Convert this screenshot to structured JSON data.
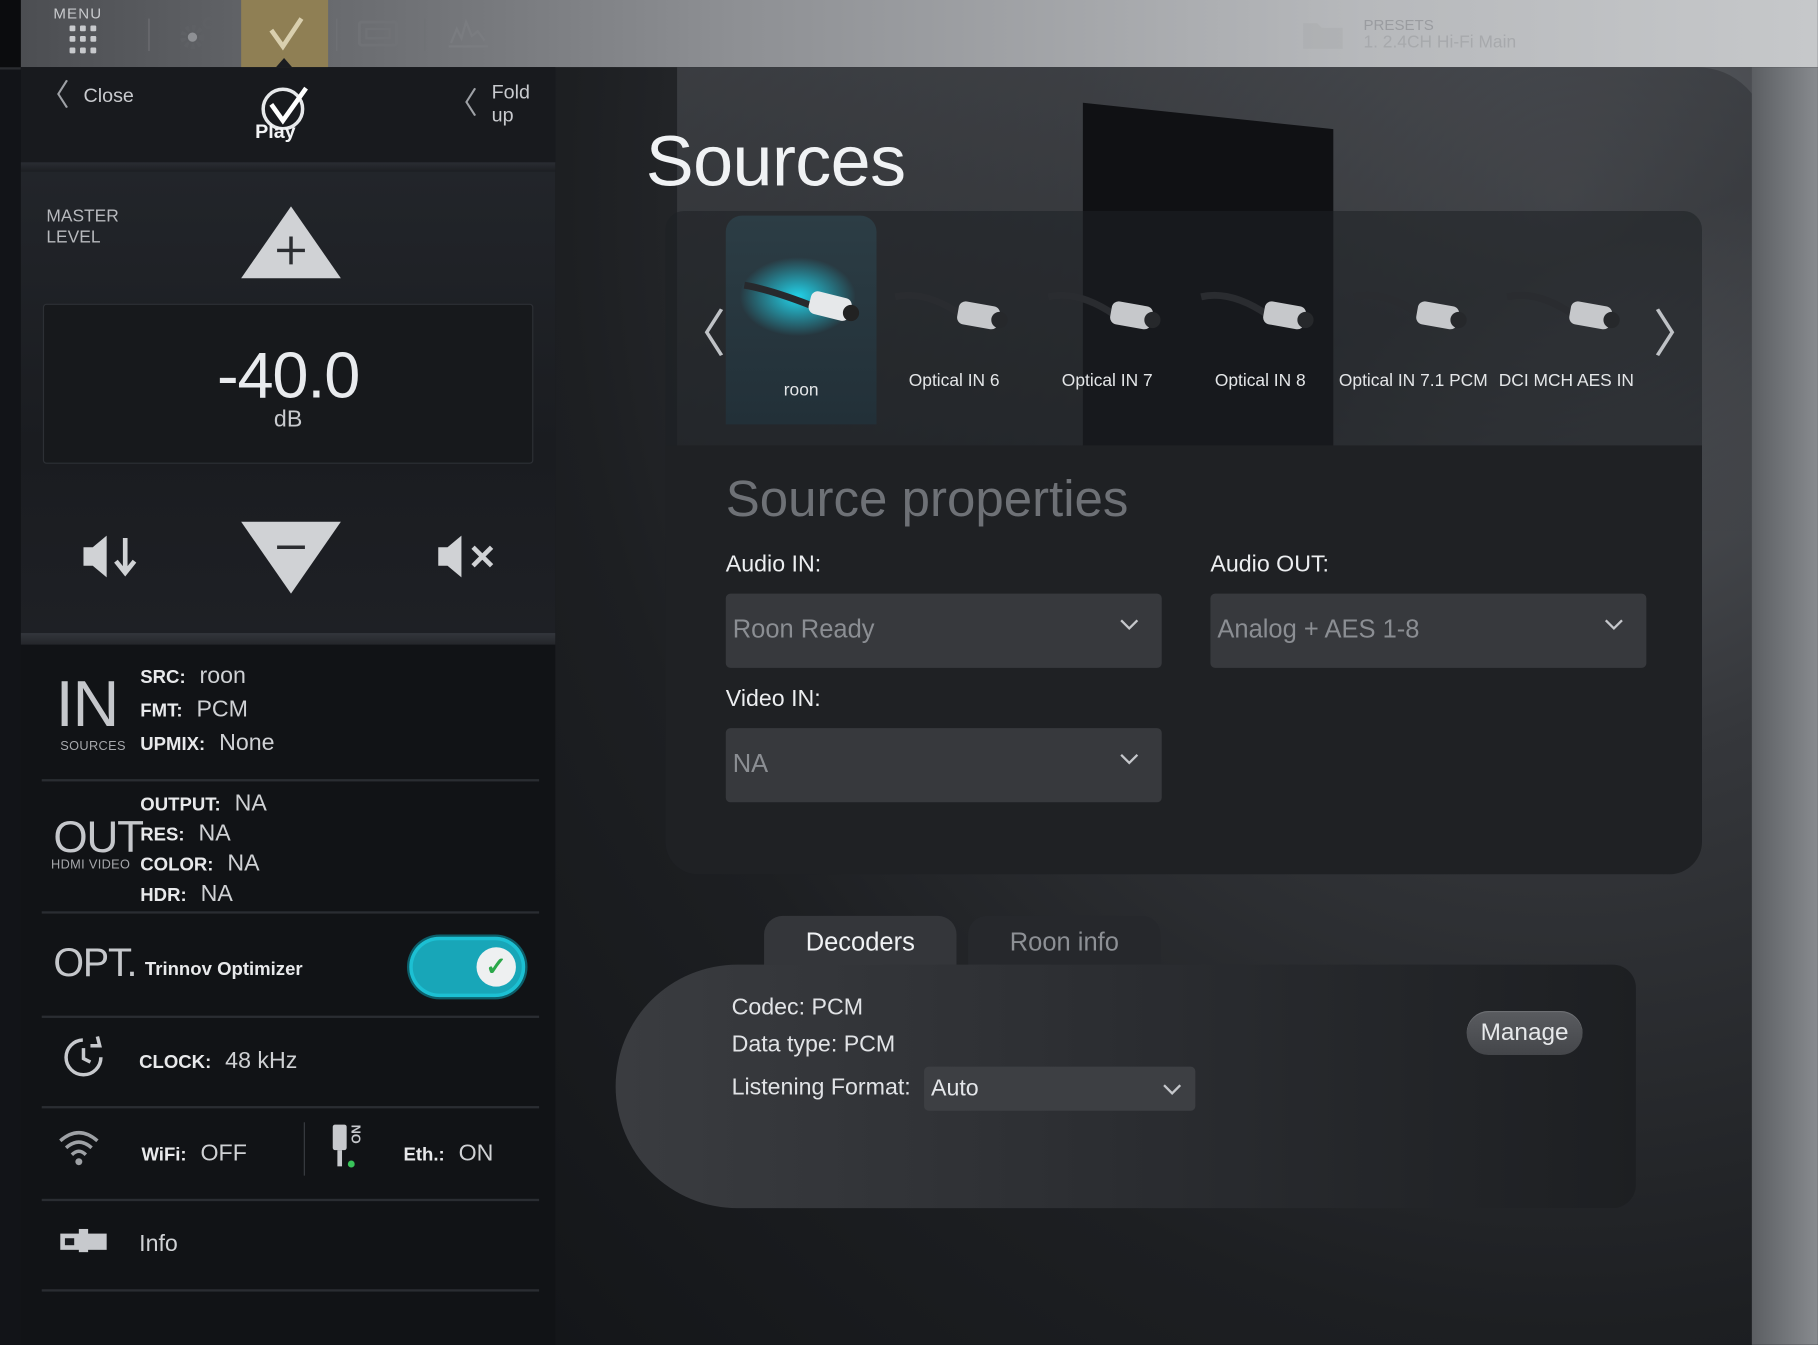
{
  "topbar": {
    "menu_label": "MENU",
    "presets_label": "PRESETS",
    "preset_current": "1. 2.4CH Hi-Fi Main"
  },
  "left_panel": {
    "close_label": "Close",
    "foldup_label": "Fold up",
    "logo_text": "Play",
    "master_level_label": "MASTER LEVEL",
    "volume_value": "-40.0",
    "volume_unit": "dB",
    "in_section": {
      "big": "IN",
      "small": "SOURCES",
      "src_key": "SRC:",
      "src_val": "roon",
      "fmt_key": "FMT:",
      "fmt_val": "PCM",
      "upmix_key": "UPMIX:",
      "upmix_val": "None"
    },
    "out_section": {
      "big": "OUT",
      "small": "HDMI VIDEO",
      "output_key": "OUTPUT:",
      "output_val": "NA",
      "res_key": "RES:",
      "res_val": "NA",
      "color_key": "COLOR:",
      "color_val": "NA",
      "hdr_key": "HDR:",
      "hdr_val": "NA"
    },
    "opt_section": {
      "big": "OPT.",
      "label": "Trinnov Optimizer",
      "enabled": true
    },
    "clock_section": {
      "key": "CLOCK:",
      "val": "48 kHz"
    },
    "network_section": {
      "wifi_key": "WiFi:",
      "wifi_val": "OFF",
      "eth_key": "Eth.:",
      "eth_val": "ON",
      "eth_icon_text": "ON"
    },
    "info_label": "Info"
  },
  "main": {
    "title": "Sources",
    "sources": [
      {
        "label": "roon",
        "active": true
      },
      {
        "label": "Optical IN 6",
        "active": false
      },
      {
        "label": "Optical IN 7",
        "active": false
      },
      {
        "label": "Optical IN 8",
        "active": false
      },
      {
        "label": "Optical IN 7.1 PCM",
        "active": false
      },
      {
        "label": "DCI MCH AES IN",
        "active": false
      }
    ],
    "properties": {
      "title": "Source properties",
      "audio_in_label": "Audio IN:",
      "audio_in_value": "Roon Ready",
      "audio_out_label": "Audio OUT:",
      "audio_out_value": "Analog + AES 1-8",
      "video_in_label": "Video IN:",
      "video_in_value": "NA"
    },
    "tabs": [
      {
        "label": "Decoders",
        "active": true
      },
      {
        "label": "Roon info",
        "active": false
      }
    ],
    "decoders": {
      "codec": "Codec: PCM",
      "data_type": "Data type: PCM",
      "listening_format_label": "Listening Format:",
      "listening_format_value": "Auto",
      "manage_label": "Manage"
    }
  },
  "colors": {
    "accent_teal": "#18a6b8",
    "active_tab_gold": "#8f7f54"
  }
}
